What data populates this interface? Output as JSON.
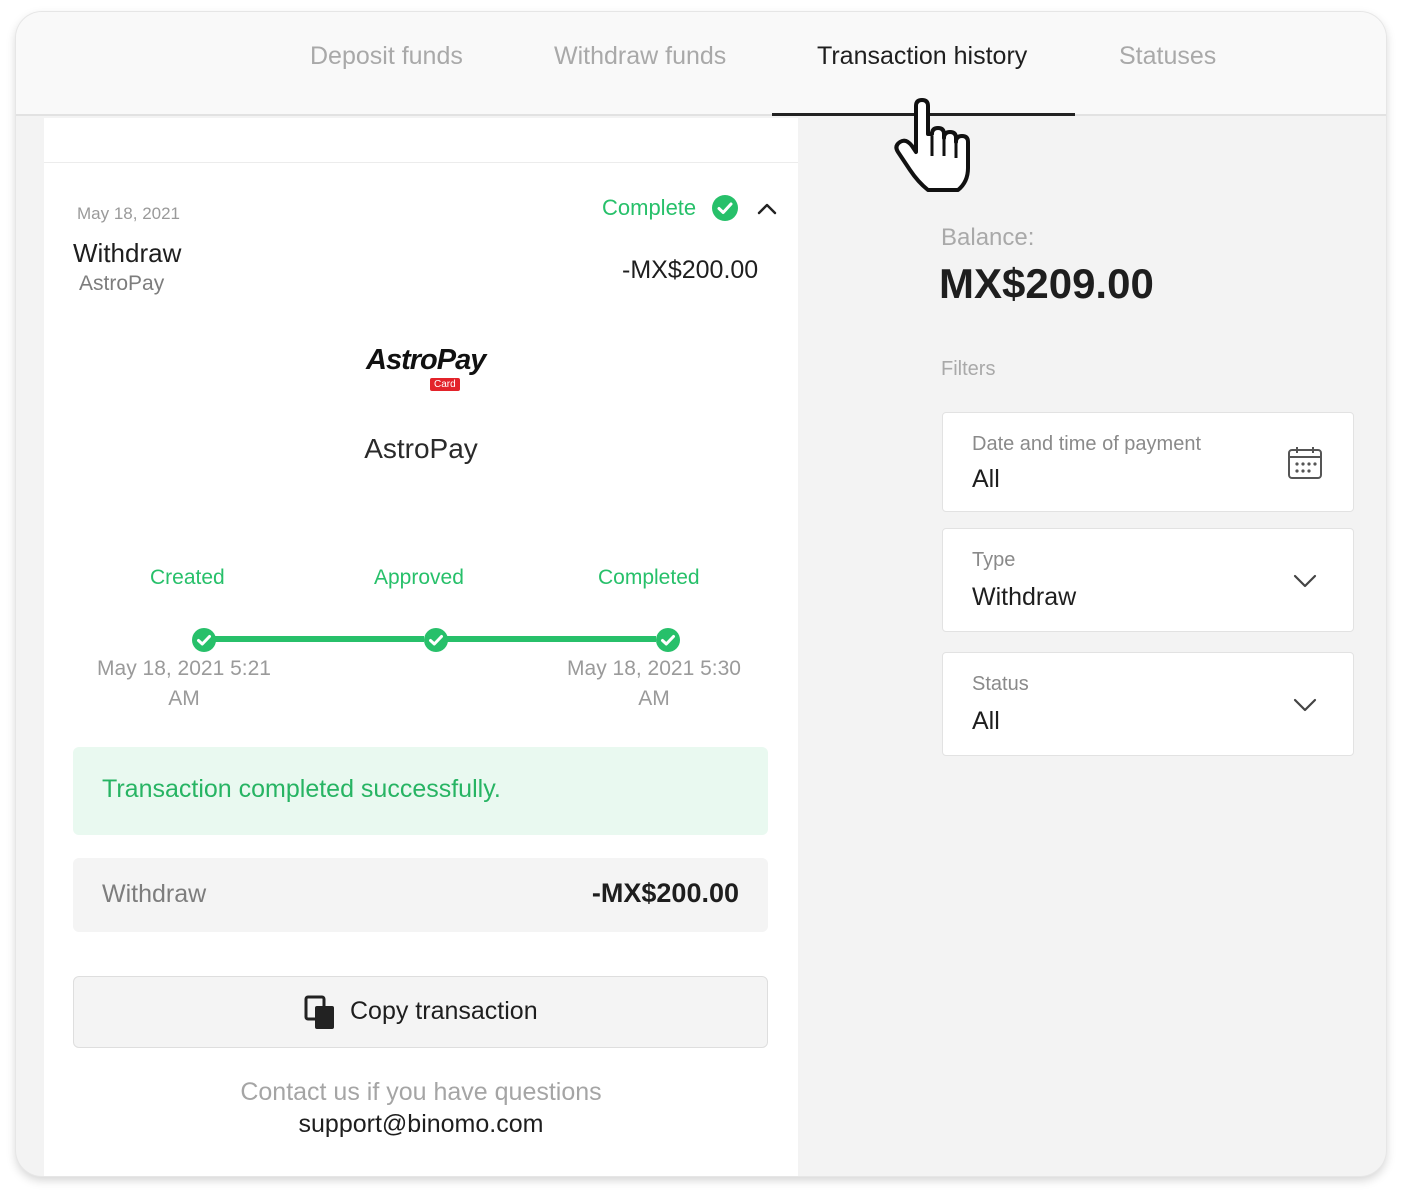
{
  "tabs": [
    {
      "label": "Deposit funds"
    },
    {
      "label": "Withdraw funds"
    },
    {
      "label": "Transaction history"
    },
    {
      "label": "Statuses"
    }
  ],
  "transaction": {
    "date": "May 18, 2021",
    "status": "Complete",
    "title": "Withdraw",
    "method": "AstroPay",
    "amount": "-MX$200.00",
    "logo_text": "AstroPay",
    "logo_badge": "Card",
    "provider_name": "AstroPay",
    "steps": [
      {
        "label": "Created",
        "time": "May 18, 2021 5:21 AM"
      },
      {
        "label": "Approved",
        "time": ""
      },
      {
        "label": "Completed",
        "time": "May 18, 2021 5:30 AM"
      }
    ],
    "success_message": "Transaction completed successfully.",
    "summary_label": "Withdraw",
    "summary_amount": "-MX$200.00",
    "copy_label": "Copy transaction",
    "contact_text": "Contact us if you have questions",
    "contact_email": "support@binomo.com"
  },
  "sidebar": {
    "balance_label": "Balance:",
    "balance_value": "MX$209.00",
    "filters_label": "Filters",
    "filters": [
      {
        "label": "Date and time of payment",
        "value": "All",
        "icon": "calendar-icon"
      },
      {
        "label": "Type",
        "value": "Withdraw",
        "icon": "chevron-down-icon"
      },
      {
        "label": "Status",
        "value": "All",
        "icon": "chevron-down-icon"
      }
    ]
  },
  "colors": {
    "accent_green": "#27c06a",
    "success_bg": "#e9f9f0",
    "text_dark": "#1e1e1e",
    "text_muted": "#a9a9a9"
  }
}
